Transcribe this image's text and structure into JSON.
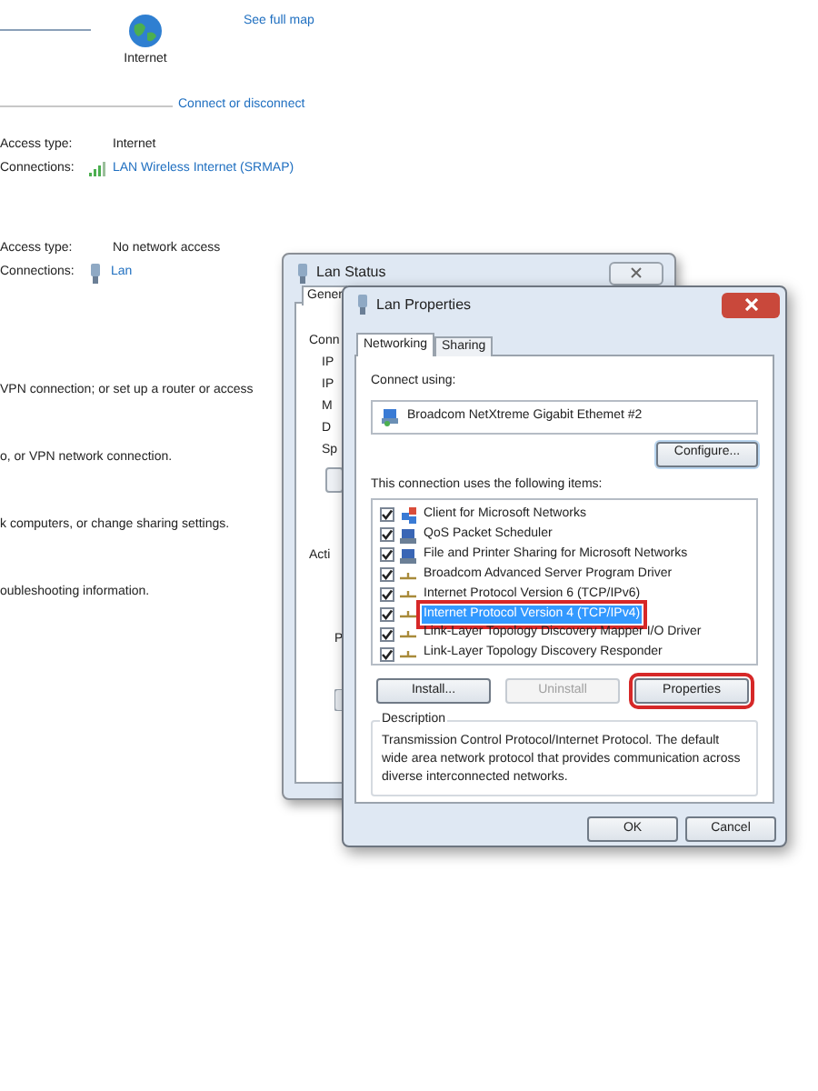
{
  "network_center": {
    "map_node": "Internet",
    "see_full_map": "See full map",
    "connect_link": "Connect or disconnect",
    "networks": [
      {
        "access_label": "Access type:",
        "access_value": "Internet",
        "connections_label": "Connections:",
        "connection": "LAN Wireless Internet (SRMAP)",
        "kind": "wireless"
      },
      {
        "access_label": "Access type:",
        "access_value": "No network access",
        "connections_label": "Connections:",
        "connection": "Lan",
        "kind": "wired"
      }
    ],
    "tasks": [
      "VPN connection; or set up a router or access",
      "o, or VPN network connection.",
      "k computers, or change sharing settings.",
      "oubleshooting information."
    ]
  },
  "status_window": {
    "title": "Lan Status",
    "tab": "Gener",
    "fragments": [
      "Conn",
      "IP",
      "IP",
      "M",
      "D",
      "Sp"
    ],
    "activity": "Acti",
    "fragment_p": "P"
  },
  "properties_window": {
    "title": "Lan Properties",
    "tabs": [
      {
        "label": "Networking",
        "selected": true
      },
      {
        "label": "Sharing",
        "selected": false
      }
    ],
    "connect_using_label": "Connect using:",
    "adapter": "Broadcom NetXtreme Gigabit Ethemet #2",
    "configure_button": "Configure...",
    "items_label": "This connection uses the following items:",
    "items": [
      {
        "label": "Client for Microsoft Networks",
        "checked": true,
        "selected": false,
        "highlighted": false,
        "kind": "client"
      },
      {
        "label": "QoS Packet Scheduler",
        "checked": true,
        "selected": false,
        "highlighted": false,
        "kind": "service"
      },
      {
        "label": "File and Printer Sharing for Microsoft Networks",
        "checked": true,
        "selected": false,
        "highlighted": false,
        "kind": "service"
      },
      {
        "label": "Broadcom Advanced Server Program Driver",
        "checked": true,
        "selected": false,
        "highlighted": false,
        "kind": "protocol"
      },
      {
        "label": "Internet Protocol Version 6 (TCP/IPv6)",
        "checked": true,
        "selected": false,
        "highlighted": false,
        "kind": "protocol"
      },
      {
        "label": "Internet Protocol Version 4 (TCP/IPv4)",
        "checked": true,
        "selected": true,
        "highlighted": true,
        "kind": "protocol"
      },
      {
        "label": "Link-Layer Topology Discovery Mapper I/O Driver",
        "checked": true,
        "selected": false,
        "highlighted": false,
        "kind": "protocol"
      },
      {
        "label": "Link-Layer Topology Discovery Responder",
        "checked": true,
        "selected": false,
        "highlighted": false,
        "kind": "protocol"
      }
    ],
    "buttons": [
      {
        "label": "Install...",
        "disabled": false,
        "highlighted": false
      },
      {
        "label": "Uninstall",
        "disabled": true,
        "highlighted": false
      },
      {
        "label": "Properties",
        "disabled": false,
        "highlighted": true
      }
    ],
    "description_title": "Description",
    "description": "Transmission Control Protocol/Internet Protocol. The default wide area network protocol that provides communication across diverse interconnected networks.",
    "ok_button": "OK",
    "cancel_button": "Cancel"
  }
}
